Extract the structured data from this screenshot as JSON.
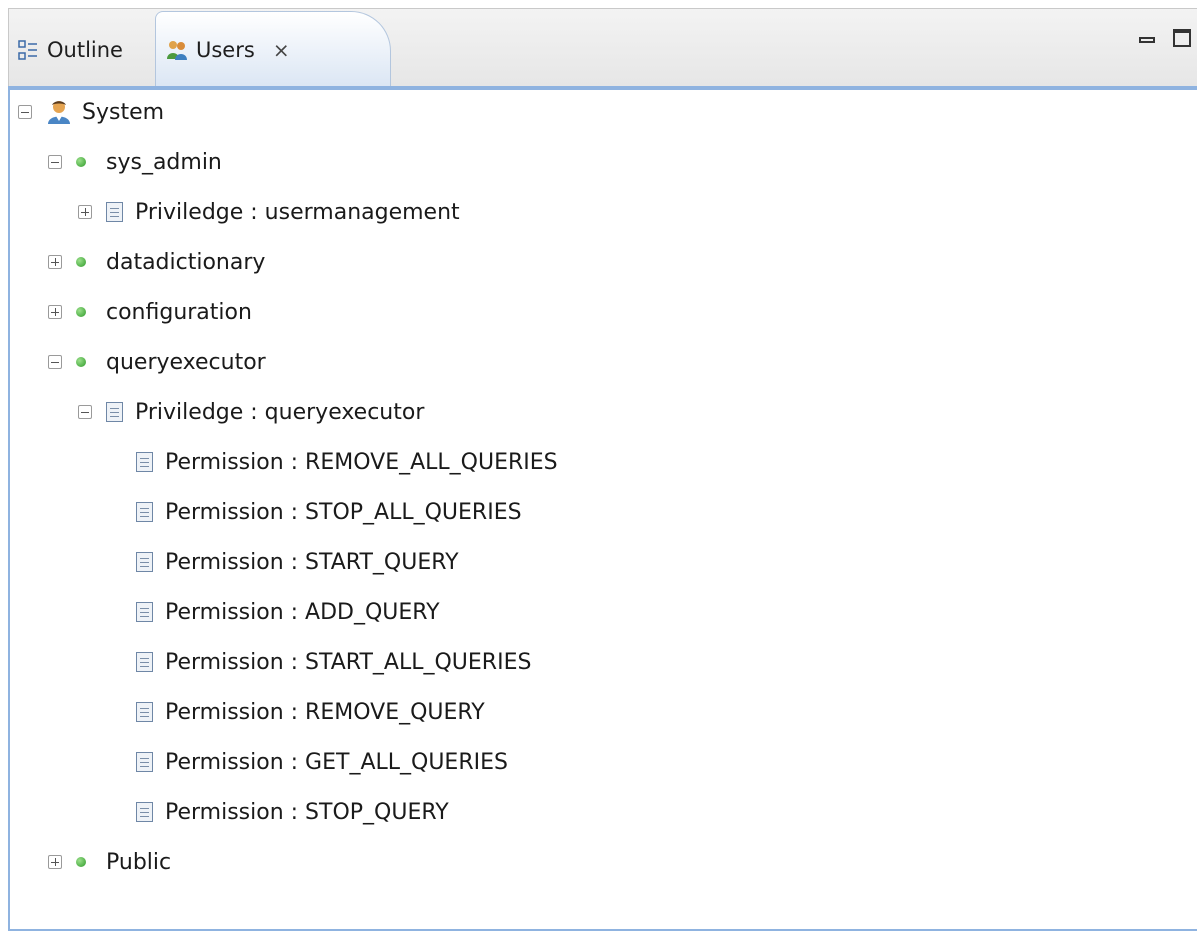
{
  "tabs": {
    "outline": {
      "label": "Outline"
    },
    "users": {
      "label": "Users",
      "close_glyph": "⨯"
    }
  },
  "tree": {
    "nodes": [
      {
        "label": "System",
        "icon": "user-icon",
        "toggle": "collapse"
      },
      {
        "label": "sys_admin",
        "icon": "status-dot-icon",
        "toggle": "collapse"
      },
      {
        "label": "Priviledge : usermanagement",
        "icon": "document-icon",
        "toggle": "expand"
      },
      {
        "label": "datadictionary",
        "icon": "status-dot-icon",
        "toggle": "expand"
      },
      {
        "label": "configuration",
        "icon": "status-dot-icon",
        "toggle": "expand"
      },
      {
        "label": "queryexecutor",
        "icon": "status-dot-icon",
        "toggle": "collapse"
      },
      {
        "label": "Priviledge : queryexecutor",
        "icon": "document-icon",
        "toggle": "collapse"
      },
      {
        "label": "Permission : REMOVE_ALL_QUERIES",
        "icon": "document-icon",
        "toggle": "none"
      },
      {
        "label": "Permission : STOP_ALL_QUERIES",
        "icon": "document-icon",
        "toggle": "none"
      },
      {
        "label": "Permission : START_QUERY",
        "icon": "document-icon",
        "toggle": "none"
      },
      {
        "label": "Permission : ADD_QUERY",
        "icon": "document-icon",
        "toggle": "none"
      },
      {
        "label": "Permission : START_ALL_QUERIES",
        "icon": "document-icon",
        "toggle": "none"
      },
      {
        "label": "Permission : REMOVE_QUERY",
        "icon": "document-icon",
        "toggle": "none"
      },
      {
        "label": "Permission : GET_ALL_QUERIES",
        "icon": "document-icon",
        "toggle": "none"
      },
      {
        "label": "Permission : STOP_QUERY",
        "icon": "document-icon",
        "toggle": "none"
      },
      {
        "label": "Public",
        "icon": "status-dot-icon",
        "toggle": "expand"
      }
    ]
  },
  "colors": {
    "accent_blue": "#8fb3e0",
    "status_green": "#2f9a2a"
  }
}
